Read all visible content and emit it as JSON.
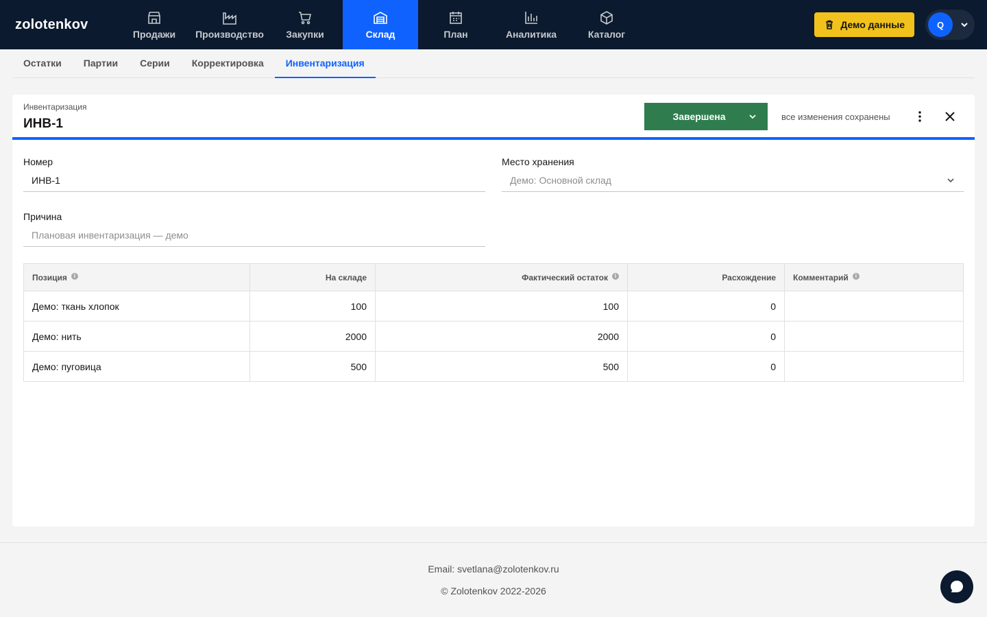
{
  "app": {
    "logo": "zolotenkov"
  },
  "nav": {
    "items": [
      {
        "label": "Продажи",
        "icon": "store-icon"
      },
      {
        "label": "Производство",
        "icon": "factory-icon"
      },
      {
        "label": "Закупки",
        "icon": "cart-icon"
      },
      {
        "label": "Склад",
        "icon": "warehouse-icon",
        "active": true
      },
      {
        "label": "План",
        "icon": "calendar-icon"
      },
      {
        "label": "Аналитика",
        "icon": "chart-icon"
      },
      {
        "label": "Каталог",
        "icon": "package-icon"
      }
    ]
  },
  "header": {
    "demo_button": "Демо данные",
    "avatar_initial": "Q"
  },
  "subtabs": [
    {
      "label": "Остатки"
    },
    {
      "label": "Партии"
    },
    {
      "label": "Серии"
    },
    {
      "label": "Корректировка"
    },
    {
      "label": "Инвентаризация",
      "active": true
    }
  ],
  "card": {
    "kicker": "Инвентаризация",
    "title": "ИНВ-1",
    "status": "Завершена",
    "saved": "все изменения сохранены"
  },
  "form": {
    "number_label": "Номер",
    "number_value": "ИНВ-1",
    "storage_label": "Место хранения",
    "storage_value": "Демо: Основной склад",
    "reason_label": "Причина",
    "reason_placeholder": "Плановая инвентаризация — демо"
  },
  "table": {
    "headers": {
      "position": "Позиция",
      "stock": "На складе",
      "actual": "Фактический остаток",
      "diff": "Расхождение",
      "comment": "Комментарий"
    },
    "rows": [
      {
        "position": "Демо: ткань хлопок",
        "stock": "100",
        "actual": "100",
        "diff": "0",
        "comment": ""
      },
      {
        "position": "Демо: нить",
        "stock": "2000",
        "actual": "2000",
        "diff": "0",
        "comment": ""
      },
      {
        "position": "Демо: пуговица",
        "stock": "500",
        "actual": "500",
        "diff": "0",
        "comment": ""
      }
    ]
  },
  "footer": {
    "email": "Email: svetlana@zolotenkov.ru",
    "copyright": "© Zolotenkov 2022-2026"
  },
  "colors": {
    "nav_bg": "#0b1a2e",
    "accent": "#0f62fe",
    "status": "#2f7d4f",
    "demo": "#f1c21b"
  }
}
